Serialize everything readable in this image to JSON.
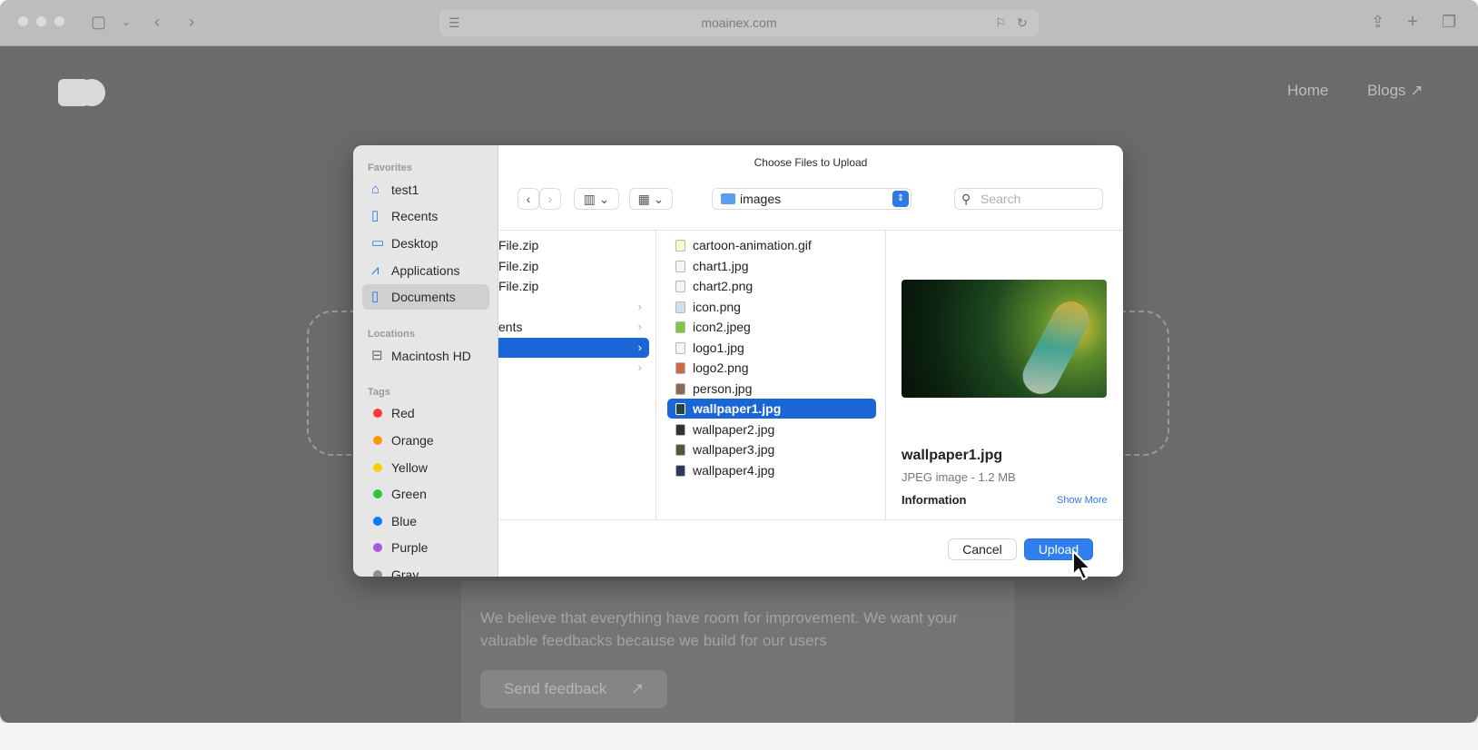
{
  "browser": {
    "url": "moainex.com"
  },
  "page": {
    "nav": {
      "home": "Home",
      "blogs": "Blogs ↗"
    },
    "feedback_text": "We believe that everything have room for improvement. We want your valuable feedbacks because we build for our users",
    "feedback_button": "Send feedback",
    "feedback_arrow": "↗"
  },
  "dialog": {
    "title": "Choose Files to Upload",
    "folder": "images",
    "search_placeholder": "Search",
    "sidebar": {
      "favorites_label": "Favorites",
      "favorites": [
        {
          "label": "test1",
          "icon": "home-icon"
        },
        {
          "label": "Recents",
          "icon": "document-icon"
        },
        {
          "label": "Desktop",
          "icon": "desktop-icon"
        },
        {
          "label": "Applications",
          "icon": "applications-icon"
        },
        {
          "label": "Documents",
          "icon": "document-icon"
        }
      ],
      "locations_label": "Locations",
      "locations": [
        {
          "label": "Macintosh HD",
          "icon": "disk-icon"
        }
      ],
      "tags_label": "Tags",
      "tags": [
        {
          "label": "Red",
          "color": "#ff3b30"
        },
        {
          "label": "Orange",
          "color": "#ff9500"
        },
        {
          "label": "Yellow",
          "color": "#ffcc00"
        },
        {
          "label": "Green",
          "color": "#28c840"
        },
        {
          "label": "Blue",
          "color": "#007aff"
        },
        {
          "label": "Purple",
          "color": "#af52de"
        },
        {
          "label": "Gray",
          "color": "#8e8e93"
        }
      ]
    },
    "parent_column": [
      {
        "label": "File.zip"
      },
      {
        "label": "File.zip"
      },
      {
        "label": "File.zip"
      },
      {
        "label": ""
      },
      {
        "label": "ents"
      },
      {
        "label": ""
      },
      {
        "label": ""
      }
    ],
    "files": [
      "cartoon-animation.gif",
      "chart1.jpg",
      "chart2.png",
      "icon.png",
      "icon2.jpeg",
      "logo1.jpg",
      "logo2.png",
      "person.jpg",
      "wallpaper1.jpg",
      "wallpaper2.jpg",
      "wallpaper3.jpg",
      "wallpaper4.jpg"
    ],
    "selected_file": "wallpaper1.jpg",
    "preview": {
      "name": "wallpaper1.jpg",
      "meta": "JPEG image - 1.2 MB",
      "info_label": "Information",
      "show_more": "Show More"
    },
    "cancel_label": "Cancel",
    "upload_label": "Upload"
  },
  "colors": {
    "accent": "#2f80ed",
    "selection": "#1a66d6"
  }
}
